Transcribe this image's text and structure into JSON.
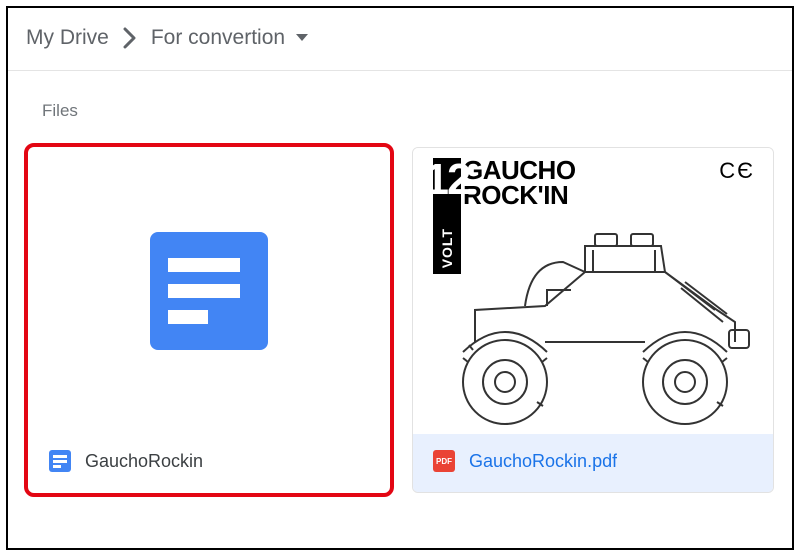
{
  "breadcrumb": {
    "root": "My Drive",
    "current": "For convertion"
  },
  "section_label": "Files",
  "files": [
    {
      "name": "GauchoRockin",
      "kind": "google-doc",
      "highlighted": true
    },
    {
      "name": "GauchoRockin.pdf",
      "kind": "pdf",
      "selected": true,
      "preview": {
        "title_line1": "GAUCHO",
        "title_line2": "ROCK'IN",
        "volt_number": "12",
        "volt_label": "VOLT",
        "ce_mark": "CЄ"
      }
    }
  ]
}
